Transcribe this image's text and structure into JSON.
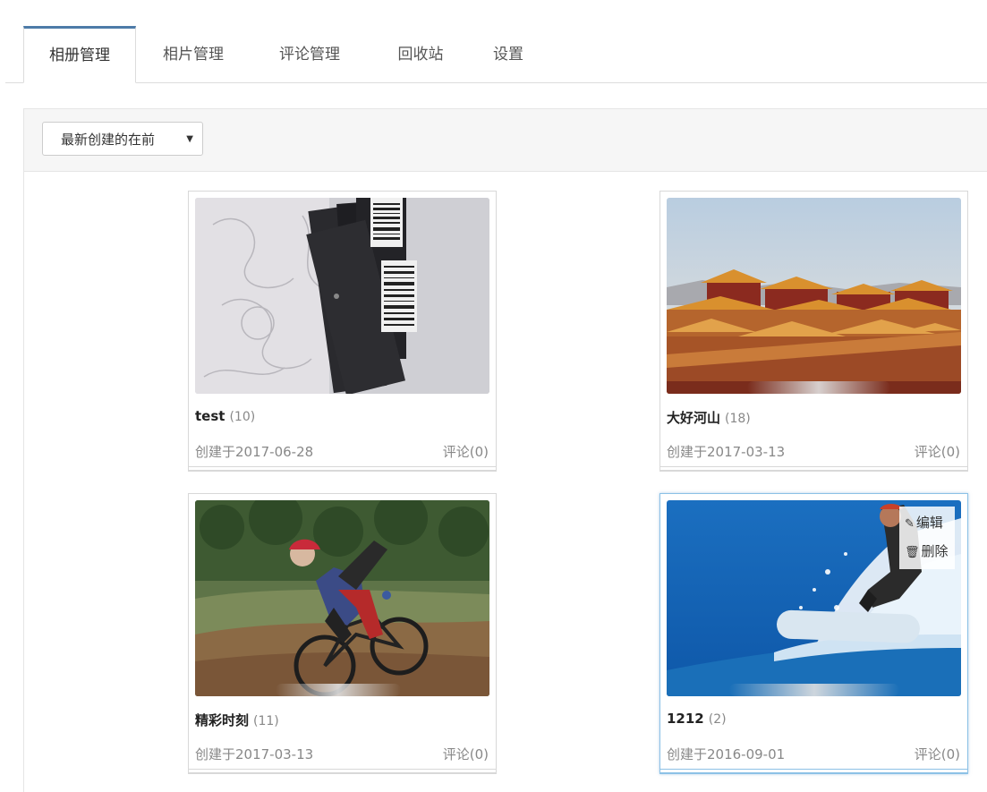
{
  "tabs": [
    {
      "label": "相册管理"
    },
    {
      "label": "相片管理"
    },
    {
      "label": "评论管理"
    },
    {
      "label": "回收站"
    },
    {
      "label": "设置"
    }
  ],
  "sort": {
    "selected": "最新创建的在前",
    "caret": "▼"
  },
  "albums": [
    {
      "title": "test",
      "count": "(10)",
      "date": "创建于2017-06-28",
      "comments": "评论(0)"
    },
    {
      "title": "大好河山",
      "count": "(18)",
      "date": "创建于2017-03-13",
      "comments": "评论(0)"
    },
    {
      "title": "精彩时刻",
      "count": "(11)",
      "date": "创建于2017-03-13",
      "comments": "评论(0)"
    },
    {
      "title": "1212",
      "count": "(2)",
      "date": "创建于2016-09-01",
      "comments": "评论(0)"
    }
  ],
  "actions": {
    "edit": "编辑",
    "delete": "删除",
    "edit_icon": "pencil-icon",
    "delete_icon": "trash-icon"
  },
  "colors": {
    "active_tab": "#4d7ba8",
    "hover_border": "#8cc1e6"
  }
}
